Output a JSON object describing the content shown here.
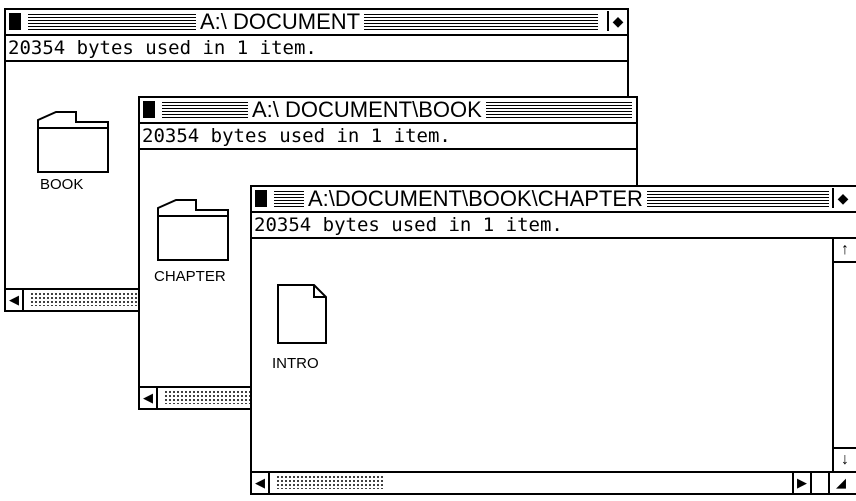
{
  "windows": [
    {
      "title": "A:\\ DOCUMENT",
      "info": "20354 bytes used in 1 item.",
      "items": [
        {
          "label": "BOOK",
          "icon": "folder-icon"
        }
      ]
    },
    {
      "title": "A:\\ DOCUMENT\\BOOK",
      "info": "20354 bytes used in 1 item.",
      "items": [
        {
          "label": "CHAPTER",
          "icon": "folder-icon"
        }
      ]
    },
    {
      "title": "A:\\DOCUMENT\\BOOK\\CHAPTER",
      "info": "20354 bytes used in 1 item.",
      "items": [
        {
          "label": "INTRO",
          "icon": "document-icon"
        }
      ]
    }
  ],
  "icons": {
    "close": "close-box-icon",
    "full": "full-box-icon",
    "left": "arrow-left-icon",
    "right": "arrow-right-icon",
    "up": "arrow-up-icon",
    "down": "arrow-down-icon",
    "size": "size-box-icon"
  }
}
